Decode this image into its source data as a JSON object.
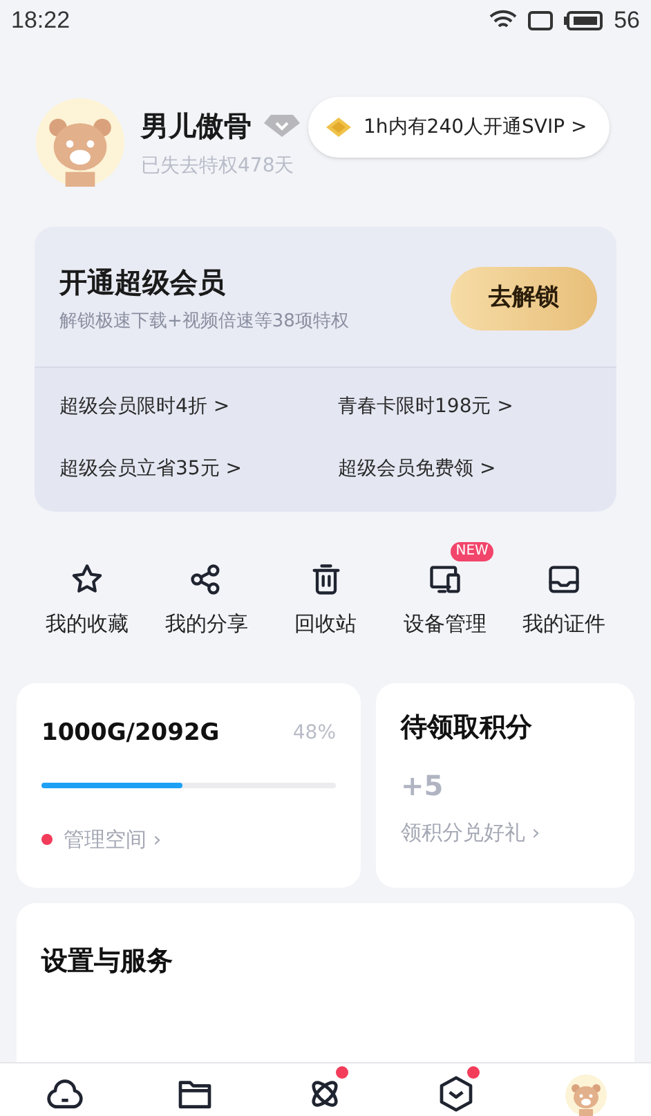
{
  "status_bar": {
    "time": "18:22",
    "battery": "56"
  },
  "profile": {
    "name": "男儿傲骨",
    "subtitle": "已失去特权478天",
    "promo": "1h内有240人开通SVIP >"
  },
  "vip_card": {
    "title": "开通超级会员",
    "subtitle": "解锁极速下载+视频倍速等38项特权",
    "button": "去解锁",
    "offers": [
      "超级会员限时4折 >",
      "青春卡限时198元 >",
      "超级会员立省35元 >",
      "超级会员免费领 >"
    ]
  },
  "shortcuts": [
    {
      "kind": "star",
      "label": "我的收藏"
    },
    {
      "kind": "share",
      "label": "我的分享"
    },
    {
      "kind": "trash",
      "label": "回收站"
    },
    {
      "kind": "devices",
      "label": "设备管理",
      "badge": "NEW"
    },
    {
      "kind": "id",
      "label": "我的证件"
    }
  ],
  "storage": {
    "usage": "1000G/2092G",
    "percent": "48%",
    "level": 0.48,
    "link": "管理空间 ›",
    "alert_dot": true
  },
  "points": {
    "title": "待领取积分",
    "value": "+5",
    "link": "领积分兑好礼 ›"
  },
  "settings": {
    "title": "设置与服务"
  },
  "bottom_nav": [
    {
      "kind": "cloud",
      "dot": false
    },
    {
      "kind": "folder",
      "dot": false
    },
    {
      "kind": "atom",
      "dot": true
    },
    {
      "kind": "box",
      "dot": true
    },
    {
      "kind": "avatar",
      "dot": false
    }
  ]
}
